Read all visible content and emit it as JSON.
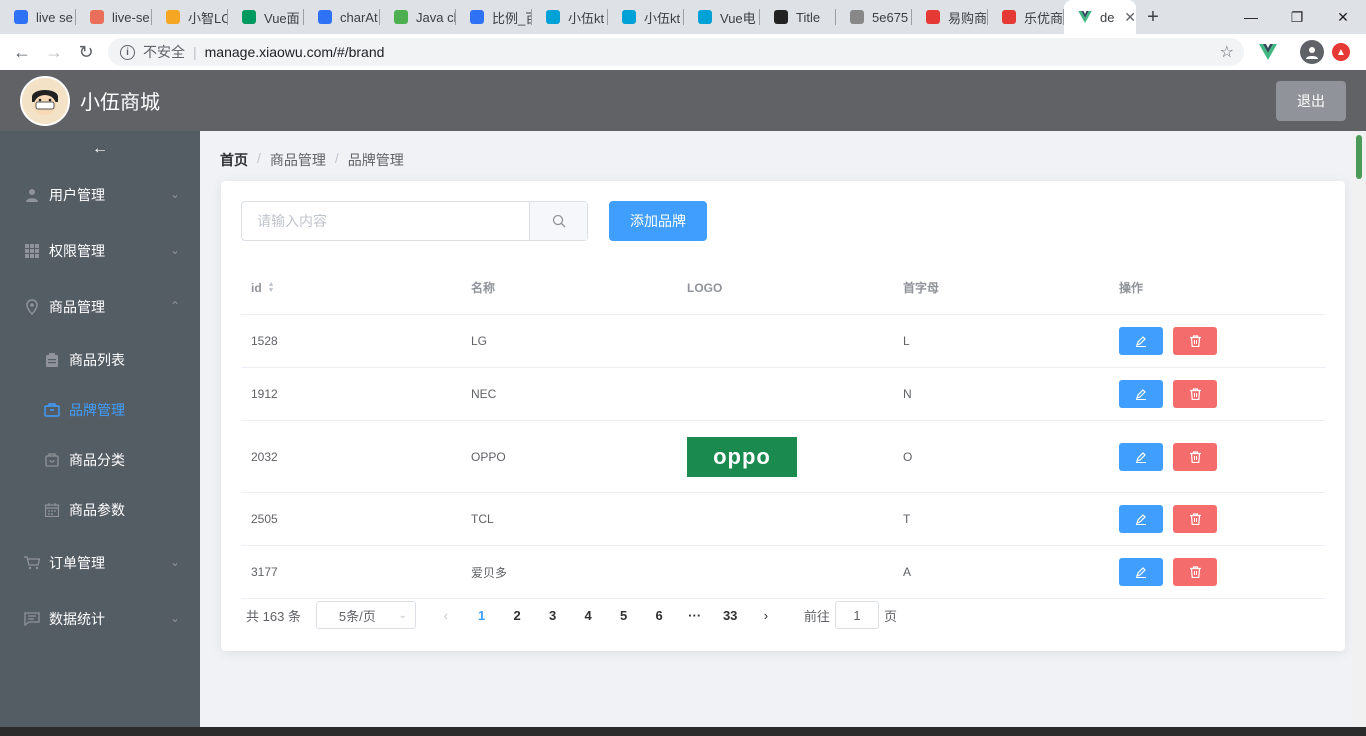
{
  "browser": {
    "tabs": [
      {
        "title": "live se",
        "icon": "paw-icon",
        "color": "#3072f6"
      },
      {
        "title": "live-se",
        "icon": "jianshu-icon",
        "color": "#ea6f5a"
      },
      {
        "title": "小智LC",
        "icon": "smile-icon",
        "color": "#f5a623"
      },
      {
        "title": "Vue面",
        "icon": "sf-icon",
        "color": "#009a61"
      },
      {
        "title": "charAt",
        "icon": "paw-icon",
        "color": "#3072f6"
      },
      {
        "title": "Java cl",
        "icon": "chat-icon",
        "color": "#4caf50"
      },
      {
        "title": "比例_百",
        "icon": "paw-icon",
        "color": "#3072f6"
      },
      {
        "title": "小伍kt",
        "icon": "bilibili-icon",
        "color": "#00a1d6"
      },
      {
        "title": "小伍kt",
        "icon": "bilibili-icon",
        "color": "#00a1d6"
      },
      {
        "title": "Vue电",
        "icon": "bilibili-icon",
        "color": "#00a1d6"
      },
      {
        "title": "Title",
        "icon": "intellij-icon",
        "color": "#222222"
      },
      {
        "title": "5e675",
        "icon": "file-icon",
        "color": "#888888"
      },
      {
        "title": "易购商",
        "icon": "shop-icon",
        "color": "#e53935"
      },
      {
        "title": "乐优商",
        "icon": "shop-icon",
        "color": "#e53935"
      }
    ],
    "active_tab": {
      "title": "de",
      "icon": "vue-icon",
      "color": "#41b883"
    },
    "new_tab": "+",
    "security_label": "不安全",
    "url": "manage.xiaowu.com/#/brand"
  },
  "header": {
    "title": "小伍商城",
    "logout_label": "退出"
  },
  "sidebar": {
    "menus": [
      {
        "label": "用户管理",
        "icon": "user-icon"
      },
      {
        "label": "权限管理",
        "icon": "grid-icon"
      },
      {
        "label": "商品管理",
        "icon": "location-icon"
      }
    ],
    "submenus": [
      {
        "label": "商品列表",
        "icon": "clipboard-icon"
      },
      {
        "label": "品牌管理",
        "icon": "box-icon",
        "active": true
      },
      {
        "label": "商品分类",
        "icon": "bag-icon"
      },
      {
        "label": "商品参数",
        "icon": "calendar-icon"
      }
    ],
    "menus_after": [
      {
        "label": "订单管理",
        "icon": "cart-icon"
      },
      {
        "label": "数据统计",
        "icon": "chat-box-icon"
      }
    ]
  },
  "breadcrumb": [
    "首页",
    "商品管理",
    "品牌管理"
  ],
  "toolbar": {
    "search_placeholder": "请输入内容",
    "add_label": "添加品牌"
  },
  "table": {
    "columns": [
      "id",
      "名称",
      "LOGO",
      "首字母",
      "操作"
    ],
    "rows": [
      {
        "id": "1528",
        "name": "LG",
        "logo": "",
        "letter": "L"
      },
      {
        "id": "1912",
        "name": "NEC",
        "logo": "",
        "letter": "N"
      },
      {
        "id": "2032",
        "name": "OPPO",
        "logo": "oppo",
        "letter": "O"
      },
      {
        "id": "2505",
        "name": "TCL",
        "logo": "",
        "letter": "T"
      },
      {
        "id": "3177",
        "name": "爱贝多",
        "logo": "",
        "letter": "A"
      }
    ]
  },
  "pagination": {
    "total_label": "共 163 条",
    "page_size_label": "5条/页",
    "pages": [
      "1",
      "2",
      "3",
      "4",
      "5",
      "6",
      "···",
      "33"
    ],
    "current": "1",
    "goto_label": "前往",
    "goto_value": "1",
    "page_suffix": "页"
  },
  "colors": {
    "primary": "#409eff",
    "danger": "#f56c6c",
    "sidebar": "#545c64",
    "header": "#606266"
  }
}
